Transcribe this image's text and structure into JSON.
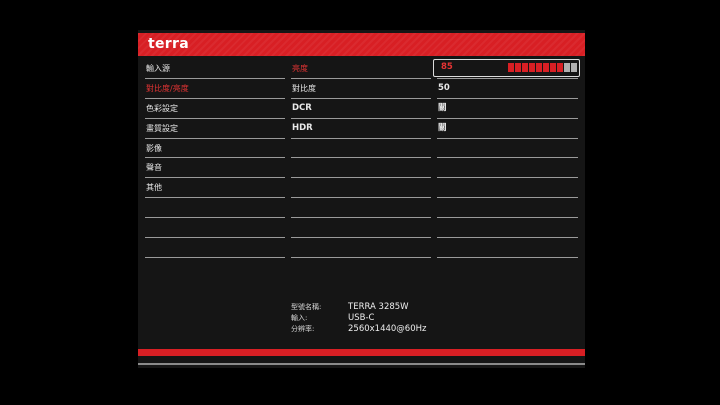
{
  "brand": "terra",
  "menu": [
    {
      "label": "輸入源",
      "active": false
    },
    {
      "label": "對比度/亮度",
      "active": true
    },
    {
      "label": "色彩設定",
      "active": false
    },
    {
      "label": "畫質設定",
      "active": false
    },
    {
      "label": "影像",
      "active": false
    },
    {
      "label": "聲音",
      "active": false
    },
    {
      "label": "其他",
      "active": false
    },
    {
      "label": "",
      "active": false
    },
    {
      "label": "",
      "active": false
    },
    {
      "label": "",
      "active": false
    }
  ],
  "submenu": [
    {
      "label": "亮度",
      "active": true
    },
    {
      "label": "對比度",
      "active": false
    },
    {
      "label": "DCR",
      "active": false
    },
    {
      "label": "HDR",
      "active": false
    },
    {
      "label": "",
      "active": false
    },
    {
      "label": "",
      "active": false
    },
    {
      "label": "",
      "active": false
    },
    {
      "label": "",
      "active": false
    },
    {
      "label": "",
      "active": false
    },
    {
      "label": "",
      "active": false
    }
  ],
  "values": {
    "brightness": "85",
    "brightness_level": 0.85,
    "contrast": "50",
    "dcr": "關",
    "hdr": "關"
  },
  "info": {
    "model_label": "型號名稱:",
    "model_value": "TERRA 3285W",
    "input_label": "輸入:",
    "input_value": "USB-C",
    "resolution_label": "分辨率:",
    "resolution_value": "2560x1440@60Hz"
  },
  "colors": {
    "accent": "#d81f24",
    "panel": "#151515",
    "background": "#000000"
  }
}
